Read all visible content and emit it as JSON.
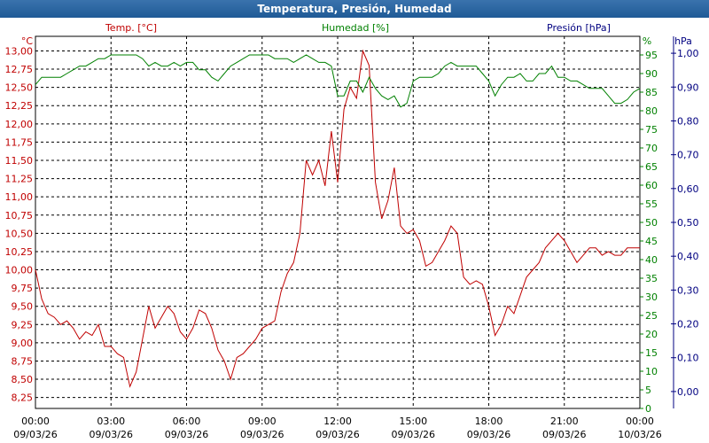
{
  "window_title": "Temperatura, Presión, Humedad",
  "colors": {
    "temp": "#c00000",
    "hum": "#008000",
    "pres": "#000080",
    "title_bg": "#2a64a0"
  },
  "chart_data": {
    "type": "line",
    "title": "Temperatura, Presión, Humedad",
    "axes": {
      "temp": {
        "label": "Temp. [°C]",
        "unit": "°C",
        "range": [
          8.1,
          13.2
        ],
        "ticks": [
          "8,25",
          "8,50",
          "8,75",
          "9,00",
          "9,25",
          "9,50",
          "9,75",
          "10,00",
          "10,25",
          "10,50",
          "10,75",
          "11,00",
          "11,25",
          "11,50",
          "11,75",
          "12,00",
          "12,25",
          "12,50",
          "12,75",
          "13,00"
        ]
      },
      "hum": {
        "label": "Humedad [%]",
        "unit": "%",
        "range": [
          0,
          100
        ],
        "ticks": [
          "0",
          "5",
          "10",
          "15",
          "20",
          "25",
          "30",
          "35",
          "40",
          "45",
          "50",
          "55",
          "60",
          "65",
          "70",
          "75",
          "80",
          "85",
          "90",
          "95"
        ]
      },
      "pres": {
        "label": "Presión [hPa]",
        "unit": "hPa",
        "range": [
          -0.05,
          1.05
        ],
        "ticks": [
          "0,00",
          "0,10",
          "0,20",
          "0,30",
          "0,40",
          "0,50",
          "0,60",
          "0,70",
          "0,80",
          "0,90",
          "1,00"
        ]
      }
    },
    "x_ticks": [
      {
        "time": "00:00",
        "date": "09/03/26"
      },
      {
        "time": "03:00",
        "date": "09/03/26"
      },
      {
        "time": "06:00",
        "date": "09/03/26"
      },
      {
        "time": "09:00",
        "date": "09/03/26"
      },
      {
        "time": "12:00",
        "date": "09/03/26"
      },
      {
        "time": "15:00",
        "date": "09/03/26"
      },
      {
        "time": "18:00",
        "date": "09/03/26"
      },
      {
        "time": "21:00",
        "date": "09/03/26"
      },
      {
        "time": "00:00",
        "date": "10/03/26"
      }
    ],
    "x_range_hours": [
      0,
      24
    ],
    "grid": true,
    "series": [
      {
        "name": "Temp. [°C]",
        "axis": "temp",
        "hours": [
          0,
          0.25,
          0.5,
          0.75,
          1,
          1.25,
          1.5,
          1.75,
          2,
          2.25,
          2.5,
          2.75,
          3,
          3.25,
          3.5,
          3.75,
          4,
          4.25,
          4.5,
          4.75,
          5,
          5.25,
          5.5,
          5.75,
          6,
          6.25,
          6.5,
          6.75,
          7,
          7.25,
          7.5,
          7.75,
          8,
          8.25,
          8.5,
          8.75,
          9,
          9.25,
          9.5,
          9.75,
          10,
          10.25,
          10.5,
          10.75,
          11,
          11.25,
          11.5,
          11.75,
          12,
          12.25,
          12.5,
          12.75,
          13,
          13.25,
          13.5,
          13.75,
          14,
          14.25,
          14.5,
          14.75,
          15,
          15.25,
          15.5,
          15.75,
          16,
          16.25,
          16.5,
          16.75,
          17,
          17.25,
          17.5,
          17.75,
          18,
          18.25,
          18.5,
          18.75,
          19,
          19.25,
          19.5,
          19.75,
          20,
          20.25,
          20.5,
          20.75,
          21,
          21.25,
          21.5,
          21.75,
          22,
          22.25,
          22.5,
          22.75,
          23,
          23.25,
          23.5,
          23.75,
          24
        ],
        "values": [
          10.0,
          9.6,
          9.4,
          9.35,
          9.25,
          9.3,
          9.2,
          9.05,
          9.15,
          9.1,
          9.25,
          8.95,
          8.95,
          8.85,
          8.8,
          8.4,
          8.6,
          9.05,
          9.5,
          9.2,
          9.35,
          9.5,
          9.4,
          9.15,
          9.05,
          9.2,
          9.45,
          9.4,
          9.2,
          8.9,
          8.75,
          8.5,
          8.8,
          8.85,
          8.95,
          9.05,
          9.2,
          9.25,
          9.3,
          9.7,
          9.95,
          10.1,
          10.5,
          11.5,
          11.3,
          11.5,
          11.15,
          11.9,
          11.2,
          12.2,
          12.5,
          12.35,
          13.0,
          12.8,
          11.2,
          10.7,
          10.95,
          11.4,
          10.6,
          10.5,
          10.55,
          10.4,
          10.05,
          10.1,
          10.25,
          10.4,
          10.6,
          10.5,
          9.9,
          9.8,
          9.85,
          9.8,
          9.5,
          9.1,
          9.25,
          9.5,
          9.4,
          9.65,
          9.9,
          10.0,
          10.1,
          10.3,
          10.4,
          10.5,
          10.4,
          10.25,
          10.1,
          10.2,
          10.3,
          10.3,
          10.2,
          10.25,
          10.2,
          10.2,
          10.3,
          10.3,
          10.3
        ]
      },
      {
        "name": "Humedad [%]",
        "axis": "hum",
        "hours": [
          0,
          0.25,
          0.5,
          0.75,
          1,
          1.25,
          1.5,
          1.75,
          2,
          2.25,
          2.5,
          2.75,
          3,
          3.25,
          3.5,
          3.75,
          4,
          4.25,
          4.5,
          4.75,
          5,
          5.25,
          5.5,
          5.75,
          6,
          6.25,
          6.5,
          6.75,
          7,
          7.25,
          7.5,
          7.75,
          8,
          8.25,
          8.5,
          8.75,
          9,
          9.25,
          9.5,
          9.75,
          10,
          10.25,
          10.5,
          10.75,
          11,
          11.25,
          11.5,
          11.75,
          12,
          12.25,
          12.5,
          12.75,
          13,
          13.25,
          13.5,
          13.75,
          14,
          14.25,
          14.5,
          14.75,
          15,
          15.25,
          15.5,
          15.75,
          16,
          16.25,
          16.5,
          16.75,
          17,
          17.25,
          17.5,
          17.75,
          18,
          18.25,
          18.5,
          18.75,
          19,
          19.25,
          19.5,
          19.75,
          20,
          20.25,
          20.5,
          20.75,
          21,
          21.25,
          21.5,
          21.75,
          22,
          22.25,
          22.5,
          22.75,
          23,
          23.25,
          23.5,
          23.75,
          24
        ],
        "values": [
          87,
          89,
          89,
          89,
          89,
          90,
          91,
          92,
          92,
          93,
          94,
          94,
          95,
          95,
          95,
          95,
          95,
          94,
          92,
          93,
          92,
          92,
          93,
          92,
          93,
          93,
          91,
          91,
          89,
          88,
          90,
          92,
          93,
          94,
          95,
          95,
          95,
          95,
          94,
          94,
          94,
          93,
          94,
          95,
          94,
          93,
          93,
          92,
          84,
          84,
          88,
          88,
          85,
          89,
          86,
          84,
          83,
          84,
          81,
          82,
          88,
          89,
          89,
          89,
          90,
          92,
          93,
          92,
          92,
          92,
          92,
          90,
          88,
          84,
          87,
          89,
          89,
          90,
          88,
          88,
          90,
          90,
          92,
          89,
          89,
          88,
          88,
          87,
          86,
          86,
          86,
          84,
          82,
          82,
          83,
          85,
          86,
          88,
          88
        ]
      }
    ]
  }
}
